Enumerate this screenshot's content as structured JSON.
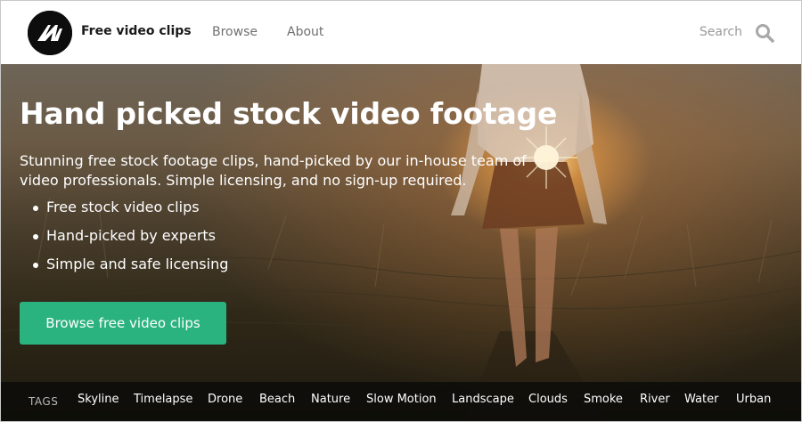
{
  "header": {
    "brand": "Free video clips",
    "nav": [
      {
        "label": "Browse"
      },
      {
        "label": "About"
      }
    ],
    "search": {
      "placeholder": "Search",
      "value": ""
    }
  },
  "hero": {
    "title": "Hand picked stock video footage",
    "description": "Stunning free stock footage clips, hand-picked by our in-house team of video professionals. Simple licensing, and no sign-up required.",
    "features": [
      "Free stock video clips",
      "Hand-picked by experts",
      "Simple and safe licensing"
    ],
    "cta_label": "Browse free video clips"
  },
  "tags": {
    "label": "TAGS",
    "items": [
      "Skyline",
      "Timelapse",
      "Drone",
      "Beach",
      "Nature",
      "Slow Motion",
      "Landscape",
      "Clouds",
      "Smoke",
      "River",
      "Water",
      "Urban"
    ]
  },
  "colors": {
    "accent": "#2bb37f",
    "logo_bg": "#0d0d0d",
    "nav_text": "#707070",
    "tags_bar": "#0a0a08"
  },
  "icons": {
    "logo": "m-logo-icon",
    "search": "search-icon"
  }
}
